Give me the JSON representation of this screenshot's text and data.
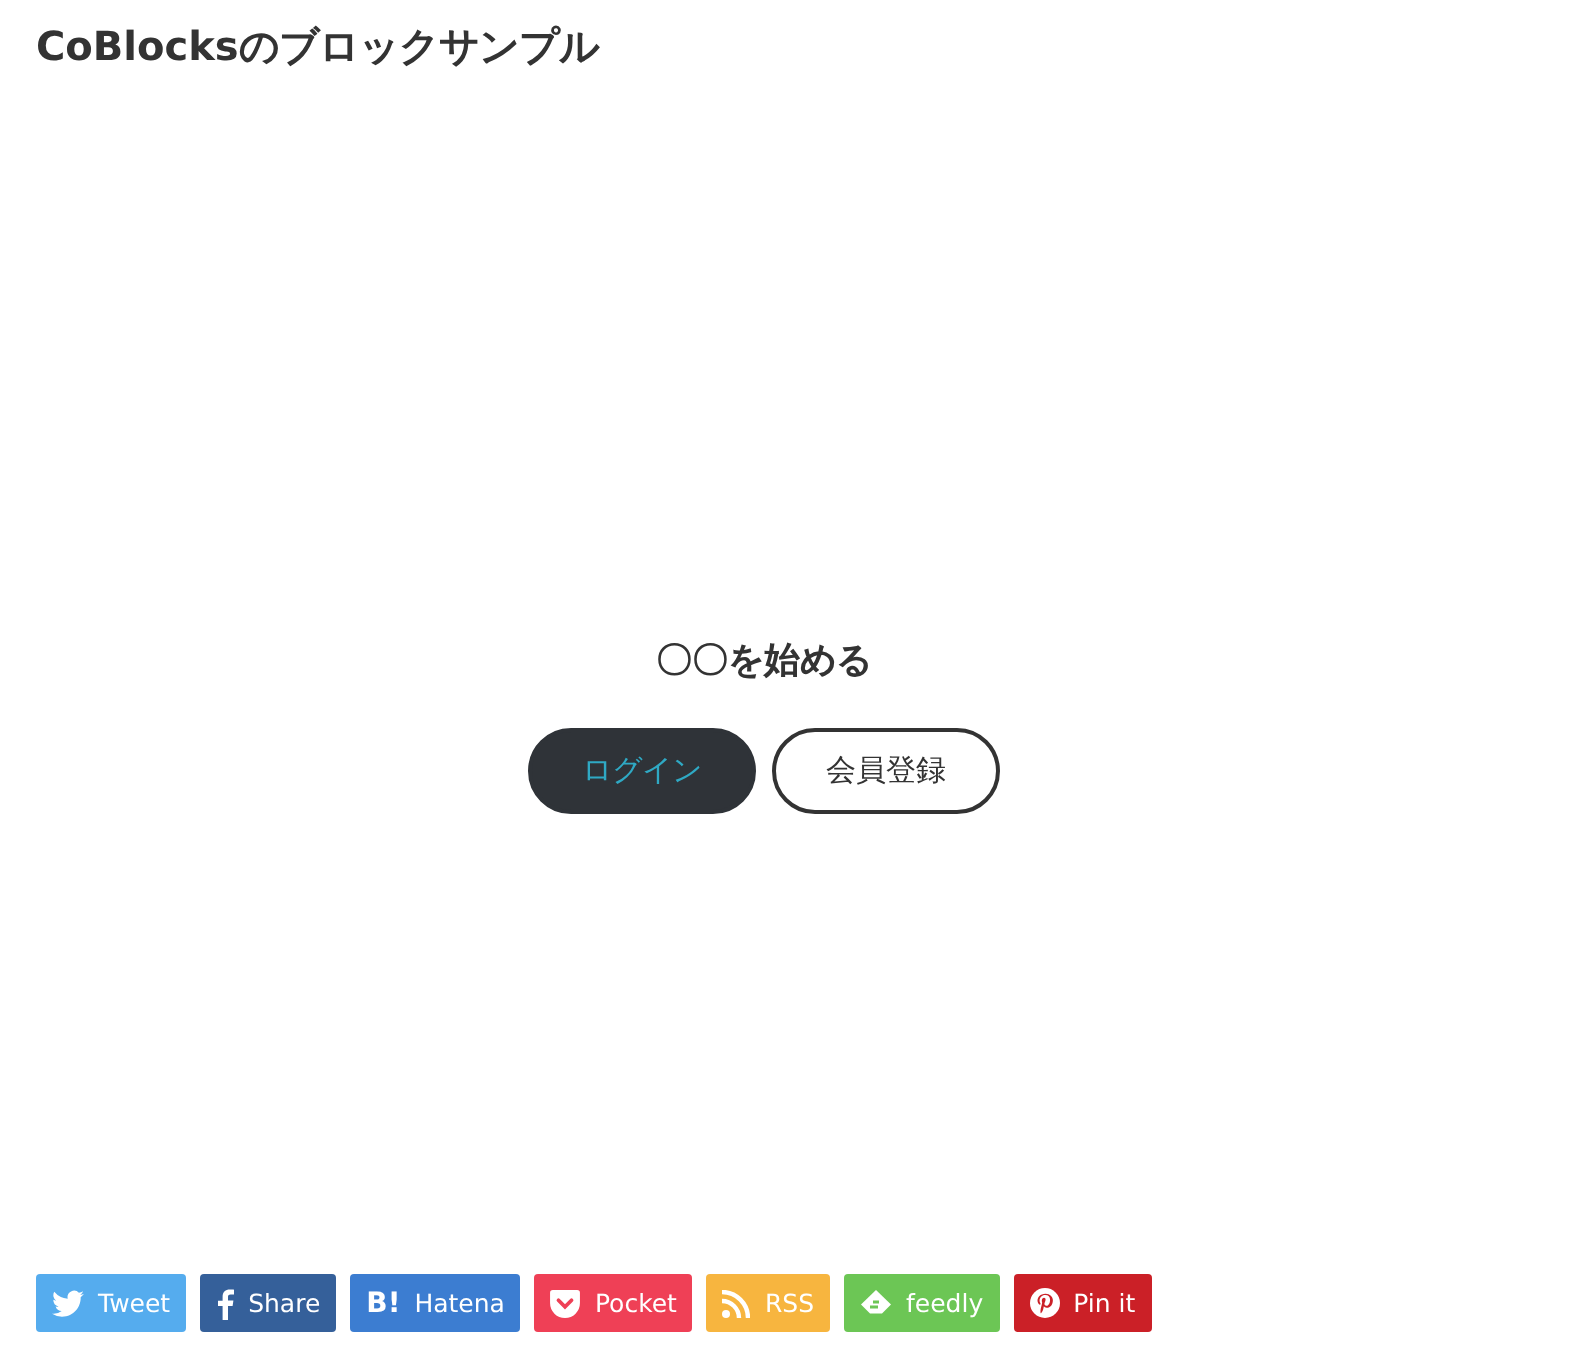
{
  "title": "CoBlocksのブロックサンプル",
  "cta": {
    "heading": "〇〇を始める",
    "buttons": [
      {
        "label": "ログイン",
        "kind": "filled"
      },
      {
        "label": "会員登録",
        "kind": "outline"
      }
    ]
  },
  "share_buttons": [
    {
      "kind": "twitter",
      "label": "Tweet",
      "color": "#55acee"
    },
    {
      "kind": "facebook",
      "label": "Share",
      "color": "#35609a"
    },
    {
      "kind": "hatena",
      "label": "Hatena",
      "icon_text": "B!",
      "color": "#3c7dd1"
    },
    {
      "kind": "pocket",
      "label": "Pocket",
      "color": "#ef4056"
    },
    {
      "kind": "rss",
      "label": "RSS",
      "color": "#f7b53f"
    },
    {
      "kind": "feedly",
      "label": "feedly",
      "color": "#6cc655"
    },
    {
      "kind": "pinterest",
      "label": "Pin it",
      "color": "#cb2027"
    }
  ]
}
